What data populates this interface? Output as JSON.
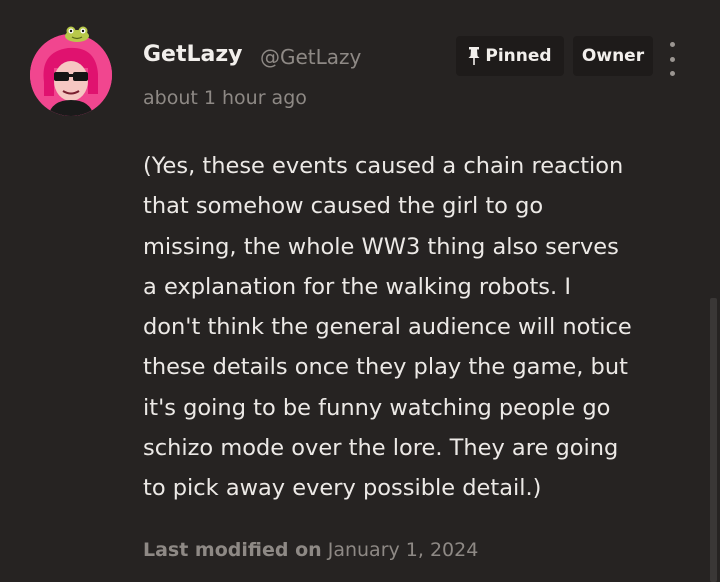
{
  "comment": {
    "author": {
      "display_name": "GetLazy",
      "handle": "@GetLazy",
      "avatar_icon": "avatar-pink-hair-sunglasses",
      "badge_icon": "frog-icon"
    },
    "timestamp": "about 1 hour ago",
    "badges": {
      "pinned": "Pinned",
      "owner": "Owner"
    },
    "body_lines": [
      "(Yes, these events caused a chain reaction",
      "that somehow caused the girl to go",
      "missing, the whole WW3 thing also serves",
      "a explanation for the walking robots. I",
      "don't think the general audience will notice",
      "these details once they play the game, but",
      "it's going to be funny watching people go",
      "schizo mode over the lore. They are going",
      "to pick away every possible detail.)"
    ],
    "modified": {
      "label": "Last modified on",
      "date": "January 1, 2024"
    }
  },
  "colors": {
    "background": "#262322",
    "text": "#ece9e6",
    "muted": "#8e8985",
    "badge_bg": "#1e1b1a",
    "avatar_bg": "#f1468f"
  }
}
